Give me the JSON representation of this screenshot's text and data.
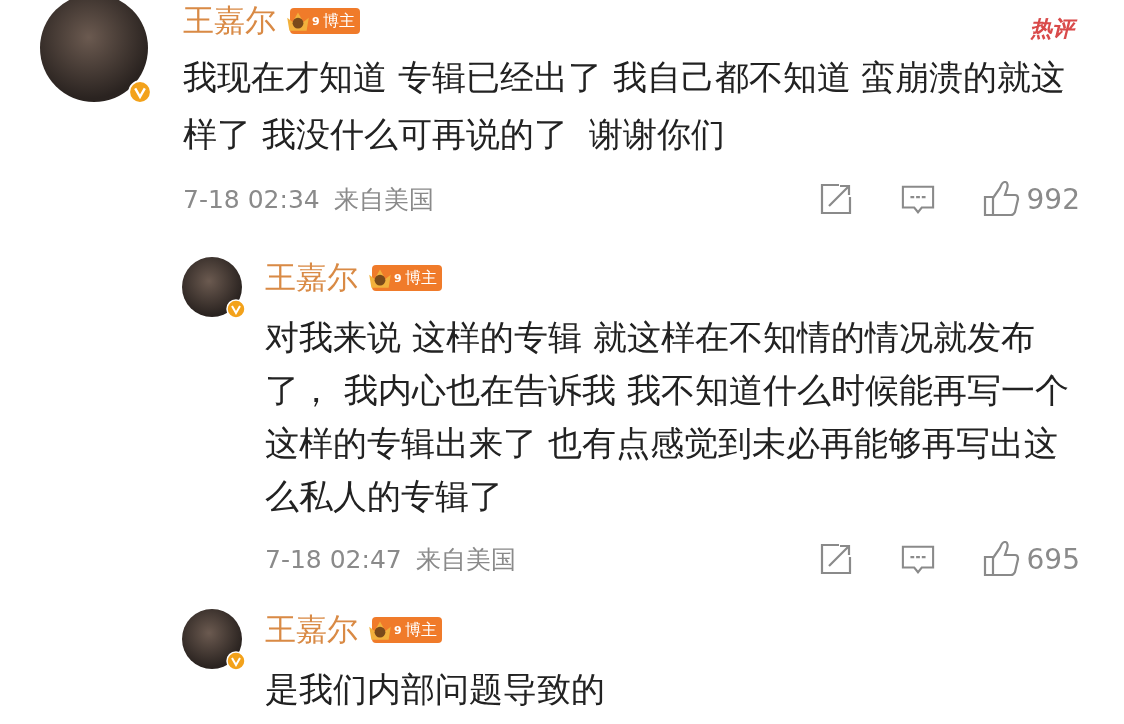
{
  "comments": [
    {
      "kind": "main",
      "author": "王嘉尔",
      "badge": {
        "level": "9",
        "label": "博主"
      },
      "verified": true,
      "tag": "热评",
      "text": "我现在才知道 专辑已经出了 我自己都不知道 蛮崩溃的就这样了 我没什么可再说的了  谢谢你们",
      "time": "7-18 02:34",
      "location": "来自美国",
      "likes": "992"
    },
    {
      "kind": "reply",
      "author": "王嘉尔",
      "badge": {
        "level": "9",
        "label": "博主"
      },
      "verified": true,
      "text": "对我来说 这样的专辑 就这样在不知情的情况就发布了， 我内心也在告诉我 我不知道什么时候能再写一个这样的专辑出来了 也有点感觉到未必再能够再写出这么私人的专辑了",
      "time": "7-18 02:47",
      "location": "来自美国",
      "likes": "695"
    },
    {
      "kind": "reply",
      "author": "王嘉尔",
      "badge": {
        "level": "9",
        "label": "博主"
      },
      "verified": true,
      "text": "是我们内部问题导致的"
    }
  ]
}
